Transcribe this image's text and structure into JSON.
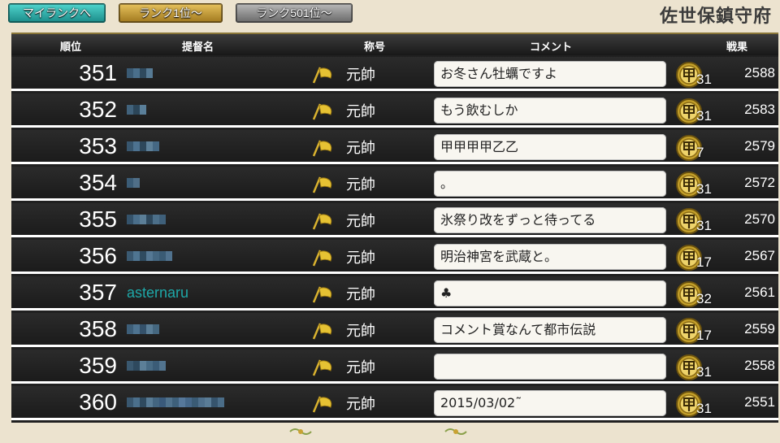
{
  "nav": {
    "my_rank": "マイランクへ",
    "rank_1": "ランク1位～",
    "rank_501": "ランク501位～"
  },
  "base_name": "佐世保鎮守府",
  "columns": {
    "rank": "順位",
    "name": "提督名",
    "title": "称号",
    "comment": "コメント",
    "score": "戦果"
  },
  "colors": {
    "accent_teal": "#1ea8a8",
    "gold": "#e2b728"
  },
  "rows": [
    {
      "rank": "351",
      "name": "",
      "title": "元帥",
      "comment": "お冬さん牡蠣ですよ",
      "medal_count": "31",
      "score": "2588"
    },
    {
      "rank": "352",
      "name": "",
      "title": "元帥",
      "comment": "もう飲むしか",
      "medal_count": "31",
      "score": "2583"
    },
    {
      "rank": "353",
      "name": "",
      "title": "元帥",
      "comment": "甲甲甲甲乙乙",
      "medal_count": "7",
      "score": "2579"
    },
    {
      "rank": "354",
      "name": "",
      "title": "元帥",
      "comment": "。",
      "medal_count": "31",
      "score": "2572"
    },
    {
      "rank": "355",
      "name": "",
      "title": "元帥",
      "comment": "氷祭り改をずっと待ってる",
      "medal_count": "31",
      "score": "2570"
    },
    {
      "rank": "356",
      "name": "",
      "title": "元帥",
      "comment": "明治神宮を武蔵と。",
      "medal_count": "17",
      "score": "2567"
    },
    {
      "rank": "357",
      "name": "asternaru",
      "title": "元帥",
      "comment": "♣",
      "medal_count": "32",
      "score": "2561"
    },
    {
      "rank": "358",
      "name": "",
      "title": "元帥",
      "comment": "コメント賞なんて都市伝説",
      "medal_count": "17",
      "score": "2559"
    },
    {
      "rank": "359",
      "name": "",
      "title": "元帥",
      "comment": "",
      "medal_count": "31",
      "score": "2558"
    },
    {
      "rank": "360",
      "name": "",
      "title": "元帥",
      "comment": "2015/03/02˜",
      "medal_count": "31",
      "score": "2551"
    }
  ],
  "icons": {
    "rank_flag": "gold-flag-icon",
    "medal": "kou-medal-icon",
    "footer": "flourish-icon"
  }
}
